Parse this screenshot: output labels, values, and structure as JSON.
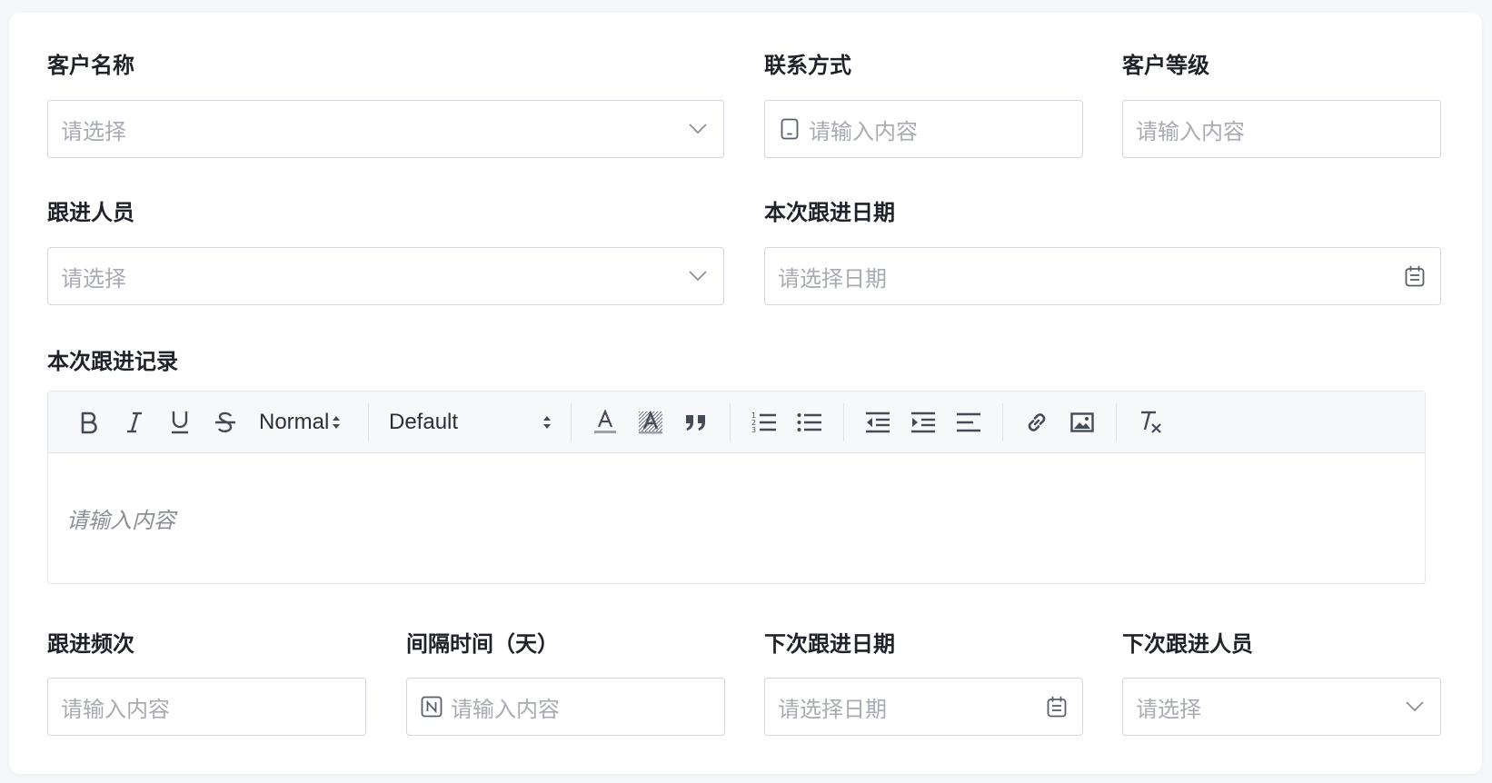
{
  "form": {
    "customer_name": {
      "label": "客户名称",
      "placeholder": "请选择"
    },
    "contact": {
      "label": "联系方式",
      "placeholder": "请输入内容"
    },
    "customer_level": {
      "label": "客户等级",
      "placeholder": "请输入内容"
    },
    "follower": {
      "label": "跟进人员",
      "placeholder": "请选择"
    },
    "follow_date": {
      "label": "本次跟进日期",
      "placeholder": "请选择日期"
    },
    "follow_record": {
      "label": "本次跟进记录",
      "placeholder": "请输入内容"
    },
    "frequency": {
      "label": "跟进频次",
      "placeholder": "请输入内容"
    },
    "interval": {
      "label": "间隔时间（天）",
      "placeholder": "请输入内容"
    },
    "next_date": {
      "label": "下次跟进日期",
      "placeholder": "请选择日期"
    },
    "next_follower": {
      "label": "下次跟进人员",
      "placeholder": "请选择"
    }
  },
  "editor": {
    "heading_select": "Normal",
    "font_select": "Default",
    "icons": [
      "bold-icon",
      "italic-icon",
      "underline-icon",
      "strikethrough-icon",
      "font-color-icon",
      "background-color-icon",
      "blockquote-icon",
      "ordered-list-icon",
      "bullet-list-icon",
      "outdent-icon",
      "indent-icon",
      "align-icon",
      "link-icon",
      "image-icon",
      "clear-format-icon"
    ]
  },
  "colors": {
    "border": "#d4d7de",
    "placeholder": "#a8abb2",
    "label": "#1f2329",
    "toolbar_bg": "#f7f8fa",
    "icon": "#444b55"
  }
}
